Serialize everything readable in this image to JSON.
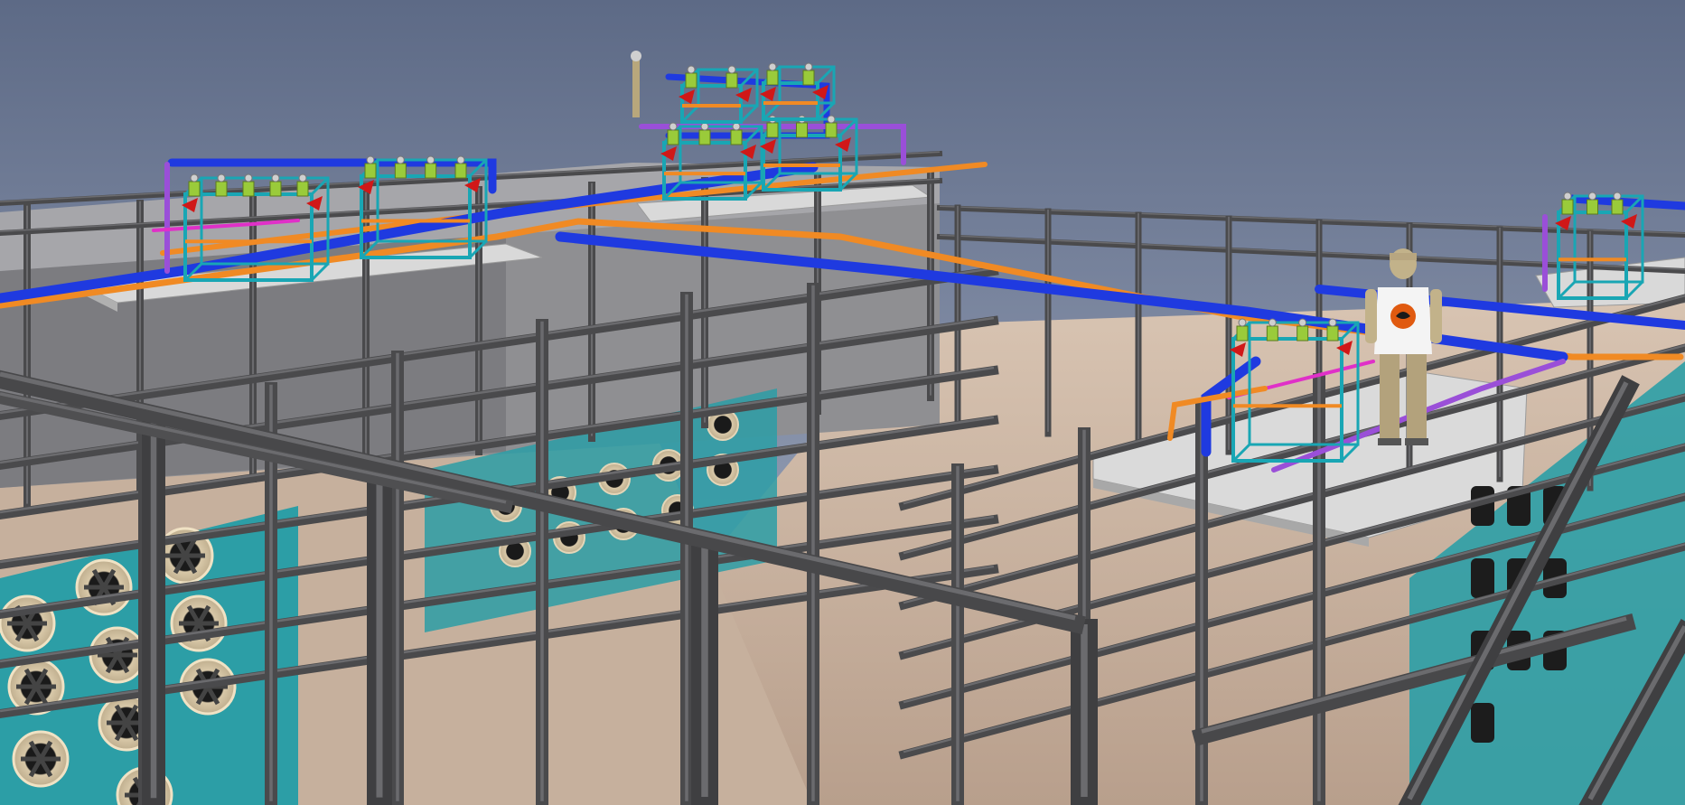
{
  "scene": {
    "colors": {
      "sky_top": "#5d6a86",
      "sky_bottom": "#a9b2c6",
      "floor": "#c8b3a2",
      "steel": "#4a4a4c",
      "steel_light": "#6b6b6e",
      "platform": "#d9d9d9",
      "wall": "#8c8c8e",
      "pipe_blue": "#1f3ae0",
      "pipe_orange": "#f08a24",
      "pipe_purple": "#9a4fd8",
      "pipe_magenta": "#e030c8",
      "frame_teal": "#19a6b4",
      "valve_red": "#d01818",
      "valve_green": "#9acb3a",
      "fan_panel": "#2c9ea6",
      "fan_disc": "#d8c8a8",
      "figure_body": "#c2b28a",
      "figure_shirt": "#f4f4f4",
      "figure_logo": "#e05a10"
    }
  }
}
